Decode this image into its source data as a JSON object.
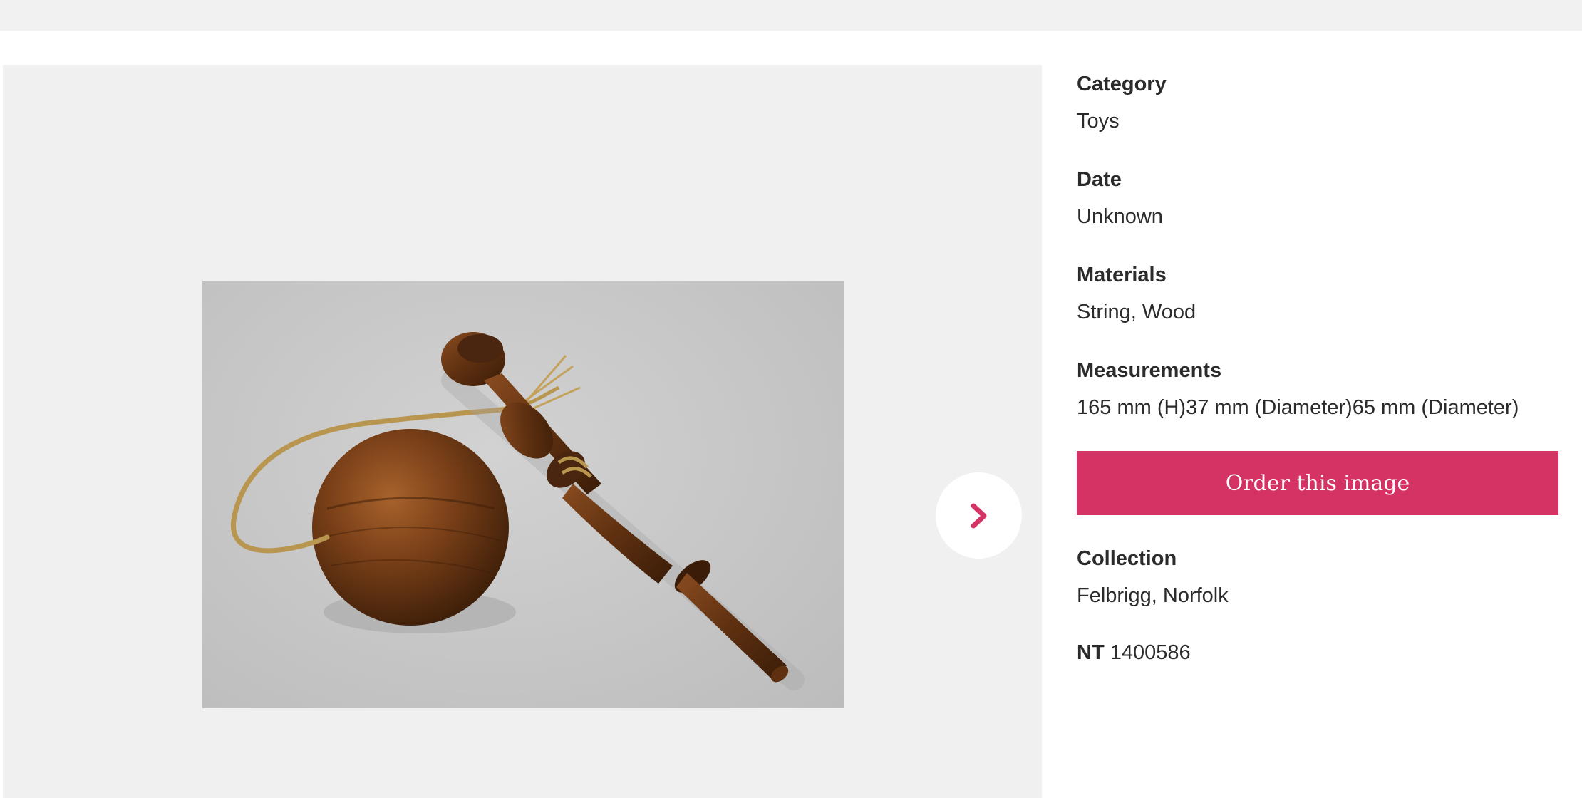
{
  "details": {
    "category": {
      "label": "Category",
      "value": "Toys"
    },
    "date": {
      "label": "Date",
      "value": "Unknown"
    },
    "materials": {
      "label": "Materials",
      "value": "String, Wood"
    },
    "measurements": {
      "label": "Measurements",
      "value": "165 mm (H)37 mm (Diameter)65 mm (Diameter)"
    },
    "order_button": "Order this image",
    "collection": {
      "label": "Collection",
      "value": "Felbrigg, Norfolk"
    },
    "nt": {
      "prefix": "NT",
      "number": "1400586"
    }
  },
  "gallery": {
    "next_icon": "chevron-right-icon",
    "accent_color": "#d43364"
  }
}
